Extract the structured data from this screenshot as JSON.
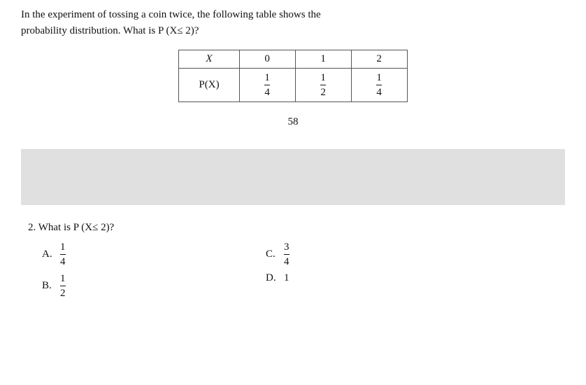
{
  "header": {
    "text_part1": "In the experiment of tossing a coin twice, the following table shows the",
    "text_part2": "probability distribution. What is P (X≤ 2)?"
  },
  "table": {
    "headers": [
      "X",
      "0",
      "1",
      "2"
    ],
    "row_label": "P(X)",
    "values": [
      {
        "numerator": "1",
        "denominator": "4"
      },
      {
        "numerator": "1",
        "denominator": "2"
      },
      {
        "numerator": "1",
        "denominator": "4"
      }
    ]
  },
  "page_number": "58",
  "question2": {
    "text": "2. What is P (X≤ 2)?",
    "choices": [
      {
        "label": "A.",
        "value_num": "1",
        "value_den": "4"
      },
      {
        "label": "B.",
        "value_num": "1",
        "value_den": "2"
      },
      {
        "label": "C.",
        "value_num": "3",
        "value_den": "4"
      },
      {
        "label": "D.",
        "value": "1"
      }
    ]
  }
}
